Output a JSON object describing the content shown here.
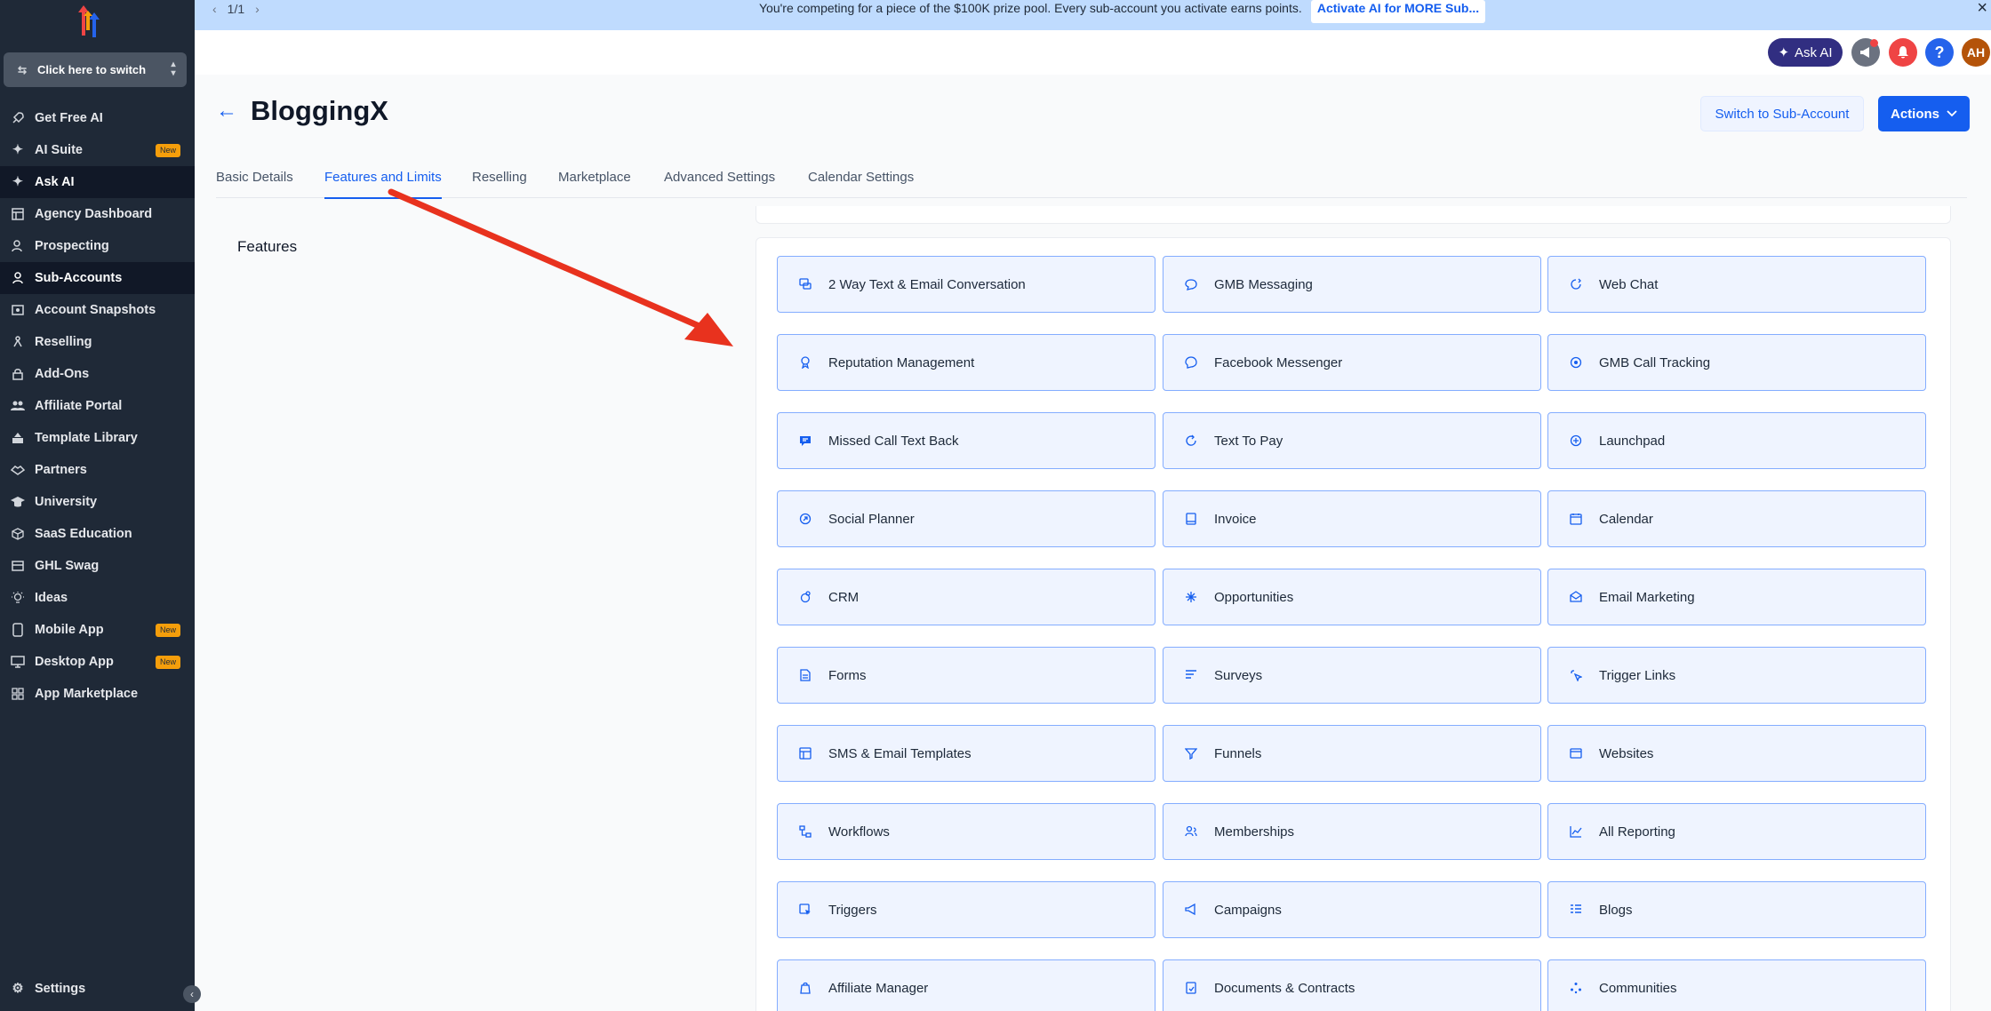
{
  "sidebar": {
    "switcher_label": "Click here to switch",
    "items": [
      {
        "label": "Get Free AI",
        "icon": "rocket-icon",
        "badge": ""
      },
      {
        "label": "AI Suite",
        "icon": "sparkle-icon",
        "badge": "New"
      },
      {
        "label": "Ask AI",
        "icon": "sparkle-icon",
        "badge": ""
      },
      {
        "label": "Agency Dashboard",
        "icon": "dashboard-icon",
        "badge": ""
      },
      {
        "label": "Prospecting",
        "icon": "prospecting-icon",
        "badge": ""
      },
      {
        "label": "Sub-Accounts",
        "icon": "user-icon",
        "badge": ""
      },
      {
        "label": "Account Snapshots",
        "icon": "snapshot-icon",
        "badge": ""
      },
      {
        "label": "Reselling",
        "icon": "reselling-icon",
        "badge": ""
      },
      {
        "label": "Add-Ons",
        "icon": "lock-icon",
        "badge": ""
      },
      {
        "label": "Affiliate Portal",
        "icon": "users-icon",
        "badge": ""
      },
      {
        "label": "Template Library",
        "icon": "template-icon",
        "badge": ""
      },
      {
        "label": "Partners",
        "icon": "handshake-icon",
        "badge": ""
      },
      {
        "label": "University",
        "icon": "graduation-cap-icon",
        "badge": ""
      },
      {
        "label": "SaaS Education",
        "icon": "box-icon",
        "badge": ""
      },
      {
        "label": "GHL Swag",
        "icon": "swag-icon",
        "badge": ""
      },
      {
        "label": "Ideas",
        "icon": "lightbulb-icon",
        "badge": ""
      },
      {
        "label": "Mobile App",
        "icon": "mobile-icon",
        "badge": "New"
      },
      {
        "label": "Desktop App",
        "icon": "monitor-icon",
        "badge": "New"
      },
      {
        "label": "App Marketplace",
        "icon": "grid-icon",
        "badge": ""
      }
    ],
    "settings_label": "Settings"
  },
  "banner": {
    "pager": "1/1",
    "message": "You're competing for a piece of the $100K prize pool. Every sub-account you activate earns points.",
    "cta": "Activate AI for MORE Sub..."
  },
  "topbar": {
    "ask_ai": "Ask AI",
    "avatar_initials": "AH"
  },
  "header": {
    "title": "BloggingX",
    "switch_button": "Switch to Sub-Account",
    "actions_button": "Actions"
  },
  "tabs": [
    {
      "label": "Basic Details"
    },
    {
      "label": "Features and Limits"
    },
    {
      "label": "Reselling"
    },
    {
      "label": "Marketplace"
    },
    {
      "label": "Advanced Settings"
    },
    {
      "label": "Calendar Settings"
    }
  ],
  "features": {
    "section_label": "Features",
    "items": [
      {
        "label": "2 Way Text & Email Conversation",
        "icon": "chat-icon"
      },
      {
        "label": "GMB Messaging",
        "icon": "message-icon"
      },
      {
        "label": "Web Chat",
        "icon": "web-chat-icon"
      },
      {
        "label": "Reputation Management",
        "icon": "award-icon"
      },
      {
        "label": "Facebook Messenger",
        "icon": "messenger-icon"
      },
      {
        "label": "GMB Call Tracking",
        "icon": "location-icon"
      },
      {
        "label": "Missed Call Text Back",
        "icon": "message-square-icon"
      },
      {
        "label": "Text To Pay",
        "icon": "refresh-icon"
      },
      {
        "label": "Launchpad",
        "icon": "launchpad-icon"
      },
      {
        "label": "Social Planner",
        "icon": "social-icon"
      },
      {
        "label": "Invoice",
        "icon": "invoice-icon"
      },
      {
        "label": "Calendar",
        "icon": "calendar-icon"
      },
      {
        "label": "CRM",
        "icon": "crm-icon"
      },
      {
        "label": "Opportunities",
        "icon": "opportunities-icon"
      },
      {
        "label": "Email Marketing",
        "icon": "mail-icon"
      },
      {
        "label": "Forms",
        "icon": "form-icon"
      },
      {
        "label": "Surveys",
        "icon": "survey-icon"
      },
      {
        "label": "Trigger Links",
        "icon": "link-icon"
      },
      {
        "label": "SMS & Email Templates",
        "icon": "template-icon"
      },
      {
        "label": "Funnels",
        "icon": "funnel-icon"
      },
      {
        "label": "Websites",
        "icon": "browser-icon"
      },
      {
        "label": "Workflows",
        "icon": "workflow-icon"
      },
      {
        "label": "Memberships",
        "icon": "members-icon"
      },
      {
        "label": "All Reporting",
        "icon": "chart-icon"
      },
      {
        "label": "Triggers",
        "icon": "trigger-icon"
      },
      {
        "label": "Campaigns",
        "icon": "campaign-icon"
      },
      {
        "label": "Blogs",
        "icon": "blog-icon"
      },
      {
        "label": "Affiliate Manager",
        "icon": "affiliate-icon"
      },
      {
        "label": "Documents & Contracts",
        "icon": "document-icon"
      },
      {
        "label": "Communities",
        "icon": "communities-icon"
      }
    ]
  },
  "colors": {
    "sidebar_bg": "#1f2937",
    "accent": "#155eef",
    "tile_bg": "#eff4ff",
    "tile_border": "#84adff",
    "annotation_arrow": "#e8321e"
  }
}
